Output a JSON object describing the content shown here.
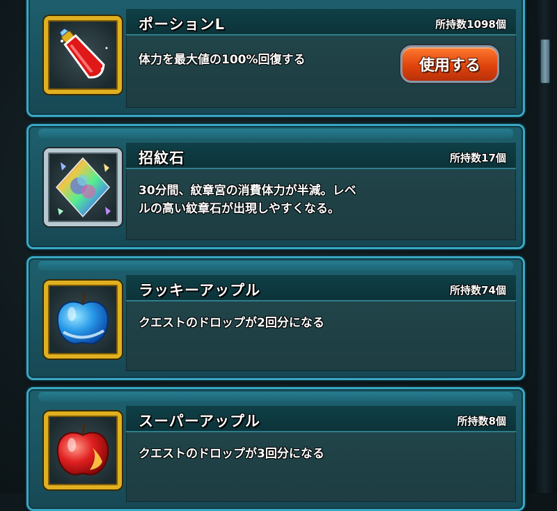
{
  "items": [
    {
      "name": "ポーションL",
      "count": "所持数1098個",
      "description": [
        "体力を最大値の100%回復する"
      ],
      "button": "使用する",
      "icon": "red-potion-icon"
    },
    {
      "name": "招紋石",
      "count": "所持数17個",
      "description": [
        "30分間、紋章宮の消費体力が半減。レベ",
        "ルの高い紋章石が出現しやすくなる。"
      ],
      "icon": "rainbow-crystal-icon"
    },
    {
      "name": "ラッキーアップル",
      "count": "所持数74個",
      "description": [
        "クエストのドロップが2回分になる"
      ],
      "icon": "blue-apple-icon"
    },
    {
      "name": "スーパーアップル",
      "count": "所持数8個",
      "description": [
        "クエストのドロップが3回分になる"
      ],
      "icon": "red-apple-icon"
    }
  ],
  "colors": {
    "card_border": "#3aa8c4",
    "button_orange": "#e0440c",
    "frame_gold": "#e0b020"
  }
}
